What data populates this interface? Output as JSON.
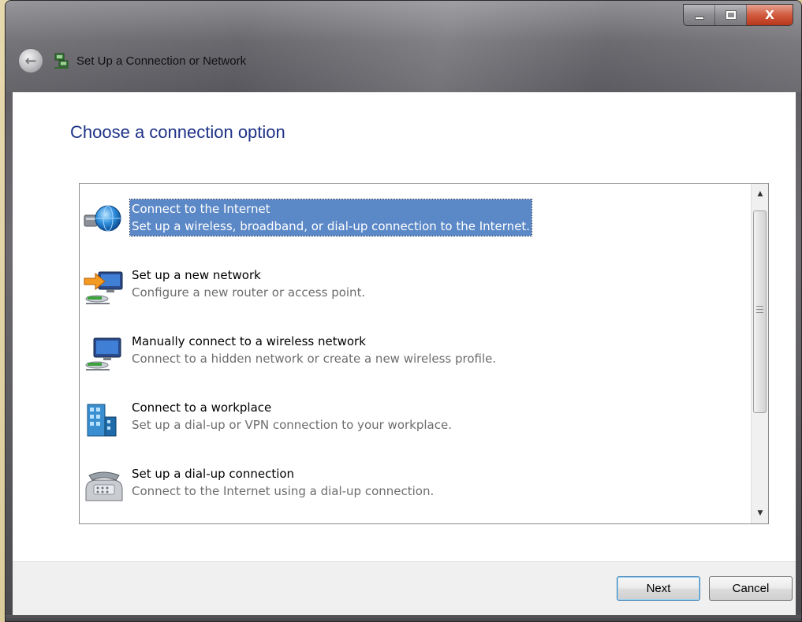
{
  "window": {
    "title": "Set Up a Connection or Network",
    "close_glyph": "X"
  },
  "page": {
    "heading": "Choose a connection option"
  },
  "options": [
    {
      "title": "Connect to the Internet",
      "description": "Set up a wireless, broadband, or dial-up connection to the Internet.",
      "icon": "globe-network-icon",
      "selected": true
    },
    {
      "title": "Set up a new network",
      "description": "Configure a new router or access point.",
      "icon": "new-network-icon",
      "selected": false
    },
    {
      "title": "Manually connect to a wireless network",
      "description": "Connect to a hidden network or create a new wireless profile.",
      "icon": "wireless-network-icon",
      "selected": false
    },
    {
      "title": "Connect to a workplace",
      "description": "Set up a dial-up or VPN connection to your workplace.",
      "icon": "workplace-building-icon",
      "selected": false
    },
    {
      "title": "Set up a dial-up connection",
      "description": "Connect to the Internet using a dial-up connection.",
      "icon": "telephone-modem-icon",
      "selected": false
    }
  ],
  "buttons": {
    "next": "Next",
    "cancel": "Cancel"
  },
  "colors": {
    "heading": "#1e3287",
    "selection": "#5b88c6",
    "description": "#6d6d6d"
  }
}
